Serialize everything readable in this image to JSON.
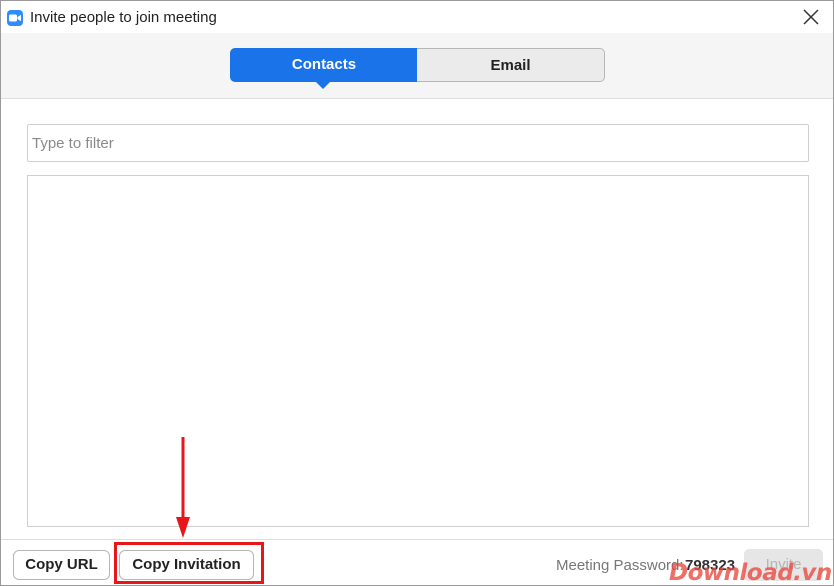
{
  "window": {
    "title": "Invite people to join meeting",
    "app_icon": "zoom-camera-icon",
    "close_icon": "close-icon"
  },
  "tabs": [
    {
      "label": "Contacts",
      "active": true
    },
    {
      "label": "Email",
      "active": false
    }
  ],
  "filter": {
    "placeholder": "Type to filter",
    "value": ""
  },
  "contacts": [],
  "footer": {
    "copy_url_label": "Copy URL",
    "copy_invitation_label": "Copy Invitation",
    "password_label": "Meeting Password:",
    "password_value": "798323",
    "invite_label": "Invite"
  },
  "annotation": {
    "highlight_color": "#e8151b",
    "arrow_color": "#e8151b"
  },
  "watermark": "Download.vn",
  "colors": {
    "accent": "#1a73e8",
    "zoom_blue": "#2d8cff"
  }
}
